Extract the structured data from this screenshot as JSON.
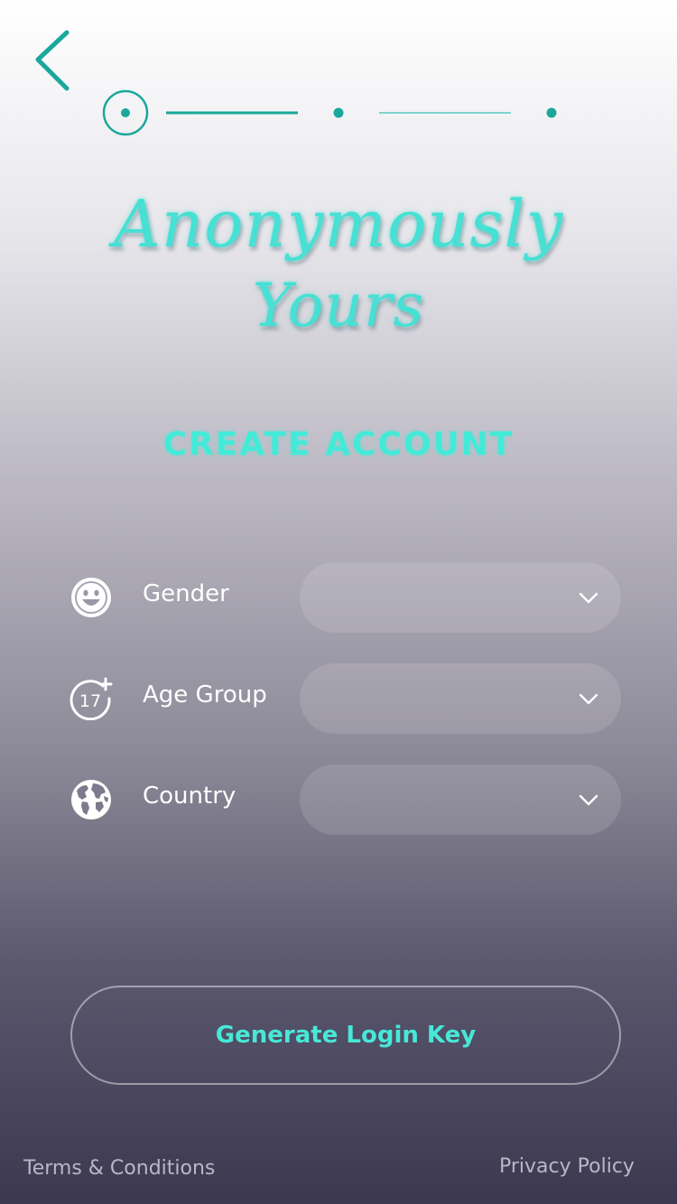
{
  "app": {
    "logo_line1": "Anonymously",
    "logo_line2": "Yours"
  },
  "progress": {
    "current_step": 1,
    "total_steps": 3
  },
  "page": {
    "title": "CREATE ACCOUNT"
  },
  "form": {
    "fields": [
      {
        "label": "Gender",
        "icon": "smiley-face-icon",
        "value": ""
      },
      {
        "label": "Age Group",
        "icon": "age-17-plus-icon",
        "value": ""
      },
      {
        "label": "Country",
        "icon": "globe-icon",
        "value": ""
      }
    ]
  },
  "actions": {
    "generate_label": "Generate Login Key"
  },
  "footer": {
    "terms_label": "Terms & Conditions",
    "privacy_label": "Privacy Policy"
  },
  "colors": {
    "accent": "#1aa89c",
    "title": "#44ead8",
    "logo": "#46e0d4"
  }
}
